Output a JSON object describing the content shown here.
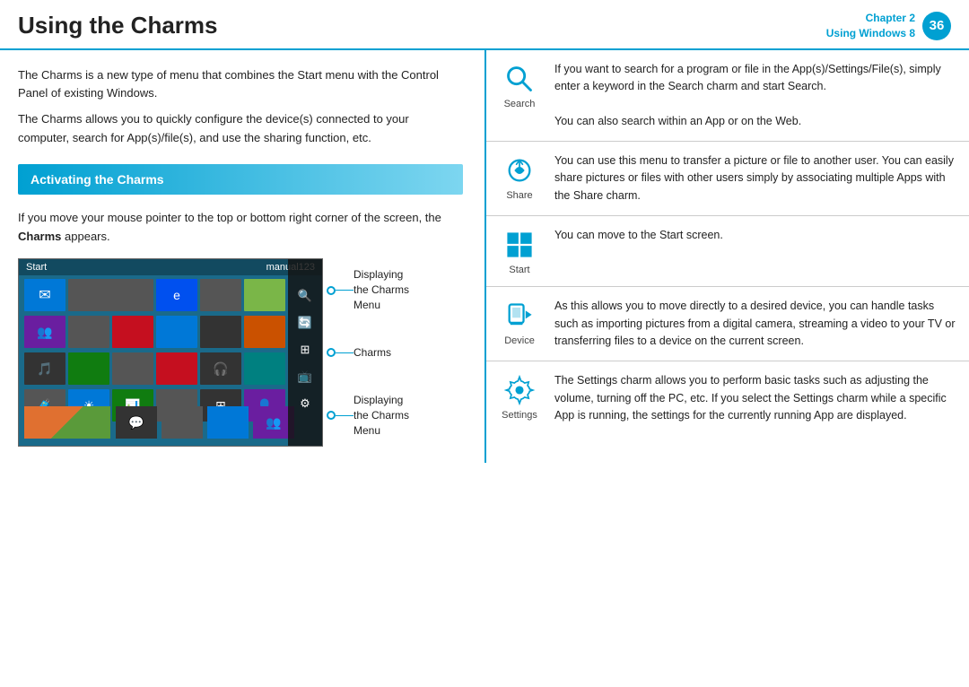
{
  "header": {
    "title": "Using the Charms",
    "chapter_label": "Chapter 2",
    "chapter_sub": "Using Windows 8",
    "chapter_num": "36"
  },
  "left": {
    "intro1": "The Charms is a new type of menu that combines the Start menu with the Control Panel of existing Windows.",
    "intro2": "The Charms allows you to quickly configure the device(s) connected to your computer, search for App(s)/file(s), and use the sharing function, etc.",
    "section_title": "Activating the Charms",
    "activating_text_pre": "If you move your mouse pointer to the top or bottom right corner of the screen, the ",
    "activating_bold": "Charms",
    "activating_text_post": " appears.",
    "screenshot_label1": "Displaying",
    "screenshot_label1b": "the Charms",
    "screenshot_label1c": "Menu",
    "screenshot_label2": "Charms",
    "screenshot_label3": "Displaying",
    "screenshot_label3b": "the Charms",
    "screenshot_label3c": "Menu",
    "win_start_label": "Start",
    "win_user_label": "manual123"
  },
  "charms": [
    {
      "id": "search",
      "label": "Search",
      "icon_type": "search",
      "desc1": "If you want to search for a program or file in the App(s)/Settings/File(s), simply enter a keyword in the Search charm and start Search.",
      "desc2": "You can also search within an App or on the Web."
    },
    {
      "id": "share",
      "label": "Share",
      "icon_type": "share",
      "desc1": "You can use this menu to transfer a picture or file to another user. You can easily share pictures or files with other users simply by associating multiple Apps with the Share charm.",
      "desc2": ""
    },
    {
      "id": "start",
      "label": "Start",
      "icon_type": "start",
      "desc1": "You can move to the Start screen.",
      "desc2": ""
    },
    {
      "id": "device",
      "label": "Device",
      "icon_type": "device",
      "desc1": "As this allows you to move directly to a desired device, you can handle tasks such as importing pictures from a digital camera, streaming a video to your TV or transferring files to a device on the current screen.",
      "desc2": ""
    },
    {
      "id": "settings",
      "label": "Settings",
      "icon_type": "settings",
      "desc1": "The Settings charm allows you to perform basic tasks such as adjusting the volume, turning off the PC, etc. If you select the Settings charm while a specific App is running, the settings for the currently running App are displayed.",
      "desc2": ""
    }
  ]
}
